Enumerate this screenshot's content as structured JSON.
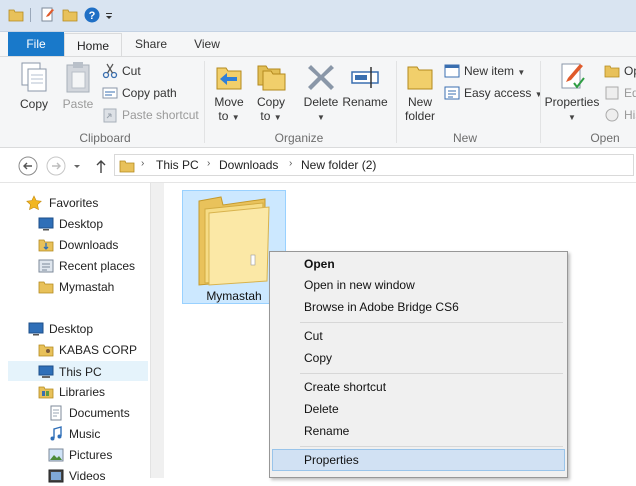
{
  "ribbon_tabs": {
    "file": "File",
    "home": "Home",
    "share": "Share",
    "view": "View"
  },
  "clipboard": {
    "copy": "Copy",
    "paste": "Paste",
    "cut": "Cut",
    "copy_path": "Copy path",
    "paste_shortcut": "Paste shortcut",
    "group": "Clipboard"
  },
  "organize": {
    "move_to_1": "Move",
    "move_to_2": "to",
    "copy_to_1": "Copy",
    "copy_to_2": "to",
    "delete": "Delete",
    "rename": "Rename",
    "group": "Organize"
  },
  "new": {
    "new_folder_1": "New",
    "new_folder_2": "folder",
    "new_item": "New item",
    "easy_access": "Easy access",
    "group": "New"
  },
  "open": {
    "properties": "Properties",
    "open_partial": "Op",
    "edit_partial": "Ed",
    "history_partial": "His",
    "group": "Open"
  },
  "breadcrumb": [
    "This PC",
    "Downloads",
    "New folder (2)"
  ],
  "sidebar": {
    "favorites": "Favorites",
    "desktop_fav": "Desktop",
    "downloads": "Downloads",
    "recent": "Recent places",
    "mymastah": "Mymastah",
    "desktop": "Desktop",
    "kabas": "KABAS CORP",
    "thispc": "This PC",
    "libraries": "Libraries",
    "documents": "Documents",
    "music": "Music",
    "pictures": "Pictures",
    "videos": "Videos"
  },
  "folder": {
    "name": "Mymastah"
  },
  "context_menu": {
    "open": "Open",
    "open_new_window": "Open in new window",
    "browse_bridge": "Browse in Adobe Bridge CS6",
    "cut": "Cut",
    "copy": "Copy",
    "create_shortcut": "Create shortcut",
    "delete": "Delete",
    "rename": "Rename",
    "properties": "Properties"
  },
  "colors": {
    "accent": "#1979ca",
    "selection": "#cce8ff",
    "menu_hover": "#d1e1f3"
  }
}
